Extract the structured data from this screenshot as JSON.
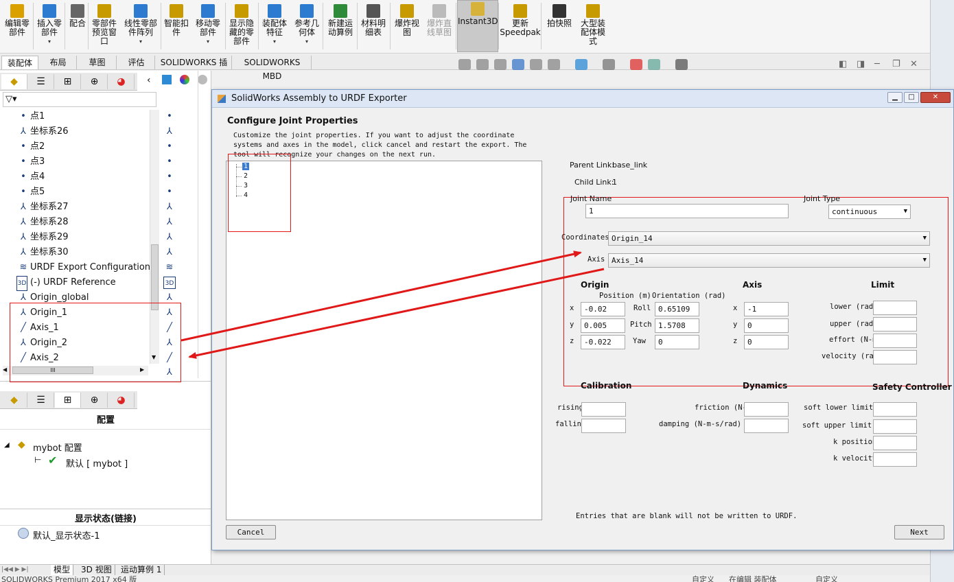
{
  "ribbon": {
    "buttons": [
      {
        "label": "编辑零\n部件",
        "caret": false,
        "disabled": false
      },
      {
        "label": "插入零\n部件",
        "caret": true,
        "disabled": false
      },
      {
        "label": "配合",
        "caret": false,
        "disabled": false
      },
      {
        "label": "零部件\n预览窗\n口",
        "caret": false,
        "disabled": false
      },
      {
        "label": "线性零部\n件阵列",
        "caret": true,
        "disabled": false
      },
      {
        "label": "智能扣\n件",
        "caret": false,
        "disabled": false
      },
      {
        "label": "移动零\n部件",
        "caret": true,
        "disabled": false
      },
      {
        "label": "显示隐\n藏的零\n部件",
        "caret": false,
        "disabled": false
      },
      {
        "label": "装配体\n特征",
        "caret": true,
        "disabled": false
      },
      {
        "label": "参考几\n何体",
        "caret": true,
        "disabled": false
      },
      {
        "label": "新建运\n动算例",
        "caret": false,
        "disabled": false
      },
      {
        "label": "材料明\n细表",
        "caret": false,
        "disabled": false
      },
      {
        "label": "爆炸视\n图",
        "caret": false,
        "disabled": false
      },
      {
        "label": "爆炸直\n线草图",
        "caret": false,
        "disabled": true
      },
      {
        "label": "Instant3D",
        "caret": false,
        "disabled": false
      },
      {
        "label": "更新\nSpeedpak",
        "caret": false,
        "disabled": false
      },
      {
        "label": "拍快照",
        "caret": false,
        "disabled": false
      },
      {
        "label": "大型装\n配体模\n式",
        "caret": false,
        "disabled": false
      }
    ]
  },
  "tabs": [
    "装配体",
    "布局",
    "草图",
    "评估",
    "SOLIDWORKS 插件",
    "SOLIDWORKS MBD"
  ],
  "feature_tree": {
    "items": [
      {
        "icon": "point-icon",
        "label": "点1"
      },
      {
        "icon": "coordinate-system-icon",
        "label": "坐标系26"
      },
      {
        "icon": "point-icon",
        "label": "点2"
      },
      {
        "icon": "point-icon",
        "label": "点3"
      },
      {
        "icon": "point-icon",
        "label": "点4"
      },
      {
        "icon": "point-icon",
        "label": "点5"
      },
      {
        "icon": "coordinate-system-icon",
        "label": "坐标系27"
      },
      {
        "icon": "coordinate-system-icon",
        "label": "坐标系28"
      },
      {
        "icon": "coordinate-system-icon",
        "label": "坐标系29"
      },
      {
        "icon": "coordinate-system-icon",
        "label": "坐标系30"
      },
      {
        "icon": "urdf-config-icon",
        "label": "URDF Export Configuration"
      },
      {
        "icon": "3d-reference-icon",
        "label": "(-) URDF Reference"
      },
      {
        "icon": "coordinate-system-icon",
        "label": "Origin_global"
      },
      {
        "icon": "coordinate-system-icon",
        "label": "Origin_1"
      },
      {
        "icon": "axis-icon",
        "label": "Axis_1"
      },
      {
        "icon": "coordinate-system-icon",
        "label": "Origin_2"
      },
      {
        "icon": "axis-icon",
        "label": "Axis_2"
      }
    ],
    "scroll_glyph": "III"
  },
  "config_panel": {
    "title": "配置",
    "root": "mybot 配置",
    "child": "默认 [ mybot ]",
    "display_state_title": "显示状态(链接)",
    "display_state_item": "默认_显示状态-1"
  },
  "bottom_tabs": [
    "模型",
    "3D 视图",
    "运动算例 1"
  ],
  "status_text": "SOLIDWORKS Premium 2017 x64 版",
  "status_right": [
    "自定义",
    "在编辑 装配体",
    "自定义"
  ],
  "dialog": {
    "title": "SolidWorks Assembly to URDF Exporter",
    "heading": "Configure Joint Properties",
    "description": "Customize the joint properties. If you want to adjust the coordinate\nsystems and axes in the model, click cancel and restart the export. The\ntool will recognize your changes on the next run.",
    "tree_nodes": [
      "1",
      "2",
      "3",
      "4"
    ],
    "parent_link_label": "Parent Link:",
    "parent_link_value": "base_link",
    "child_link_label": "Child Link:",
    "child_link_value": "1",
    "joint_name_label": "Joint Name",
    "joint_name_value": "1",
    "joint_type_label": "Joint Type",
    "joint_type_value": "continuous",
    "coordinates_label": "Coordinates",
    "coordinates_value": "Origin_14",
    "axis_label": "Axis",
    "axis_value": "Axis_14",
    "origin_title": "Origin",
    "position_label": "Position (m)",
    "orientation_label": "Orientation (rad)",
    "axis_title": "Axis",
    "limit_title": "Limit",
    "x_label": "x",
    "y_label": "y",
    "z_label": "z",
    "roll_label": "Roll",
    "pitch_label": "Pitch",
    "yaw_label": "Yaw",
    "pos_x": "-0.02",
    "pos_y": "0.005",
    "pos_z": "-0.022",
    "roll": "0.65109",
    "pitch": "1.5708",
    "yaw": "0",
    "axis_x": "-1",
    "axis_y": "0",
    "axis_z": "0",
    "lower_label": "lower (rad",
    "upper_label": "upper (rad",
    "effort_label": "effort (N-m",
    "velocity_label": "velocity (rac",
    "calibration_title": "Calibration",
    "dynamics_title": "Dynamics",
    "safety_title": "Safety Controller",
    "rising_label": "rising",
    "falling_label": "falling",
    "friction_label": "friction (N-",
    "damping_label": "damping (N-m-s/rad)",
    "soft_lower_label": "soft lower limit",
    "soft_upper_label": "soft upper limit",
    "k_position_label": "k position",
    "k_velocity_label": "k velocity",
    "footer_note": "Entries that are blank will not be written to URDF.",
    "cancel_label": "Cancel",
    "next_label": "Next"
  },
  "colors": {
    "annotation_red": "#e01818",
    "selection_blue": "#3a7bd5"
  }
}
